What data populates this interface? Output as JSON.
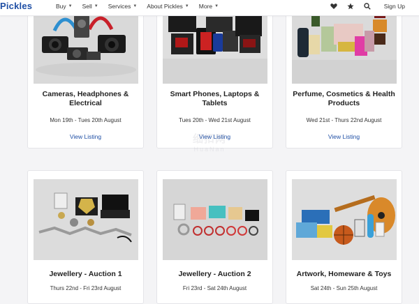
{
  "header": {
    "logo_text": "Pickles",
    "nav": [
      {
        "label": "Buy"
      },
      {
        "label": "Sell"
      },
      {
        "label": "Services"
      },
      {
        "label": "About Pickles"
      },
      {
        "label": "More"
      }
    ],
    "icons": [
      "heart-icon",
      "star-icon",
      "search-icon"
    ],
    "signup_label": "Sign Up"
  },
  "cards": [
    {
      "title": "Cameras, Headphones & Electrical",
      "dates": "Mon 19th - Tues 20th August",
      "link": "View Listing"
    },
    {
      "title": "Smart Phones, Laptops & Tablets",
      "dates": "Tues 20th - Wed 21st August",
      "link": "View Listing"
    },
    {
      "title": "Perfume, Cosmetics & Health Products",
      "dates": "Wed 21st - Thurs 22nd August",
      "link": "View Listing"
    },
    {
      "title": "Jewellery - Auction 1",
      "dates": "Thurs 22nd - Fri 23rd August",
      "link": ""
    },
    {
      "title": "Jewellery - Auction 2",
      "dates": "Fri 23rd - Sat 24th August",
      "link": ""
    },
    {
      "title": "Artwork, Homeware & Toys",
      "dates": "Sat 24th - Sun 25th August",
      "link": ""
    }
  ],
  "watermark": {
    "main": "细扣网",
    "sub": "HuaNan"
  },
  "colors": {
    "brand": "#1f4fa5",
    "page_bg": "#f4f4f6"
  }
}
